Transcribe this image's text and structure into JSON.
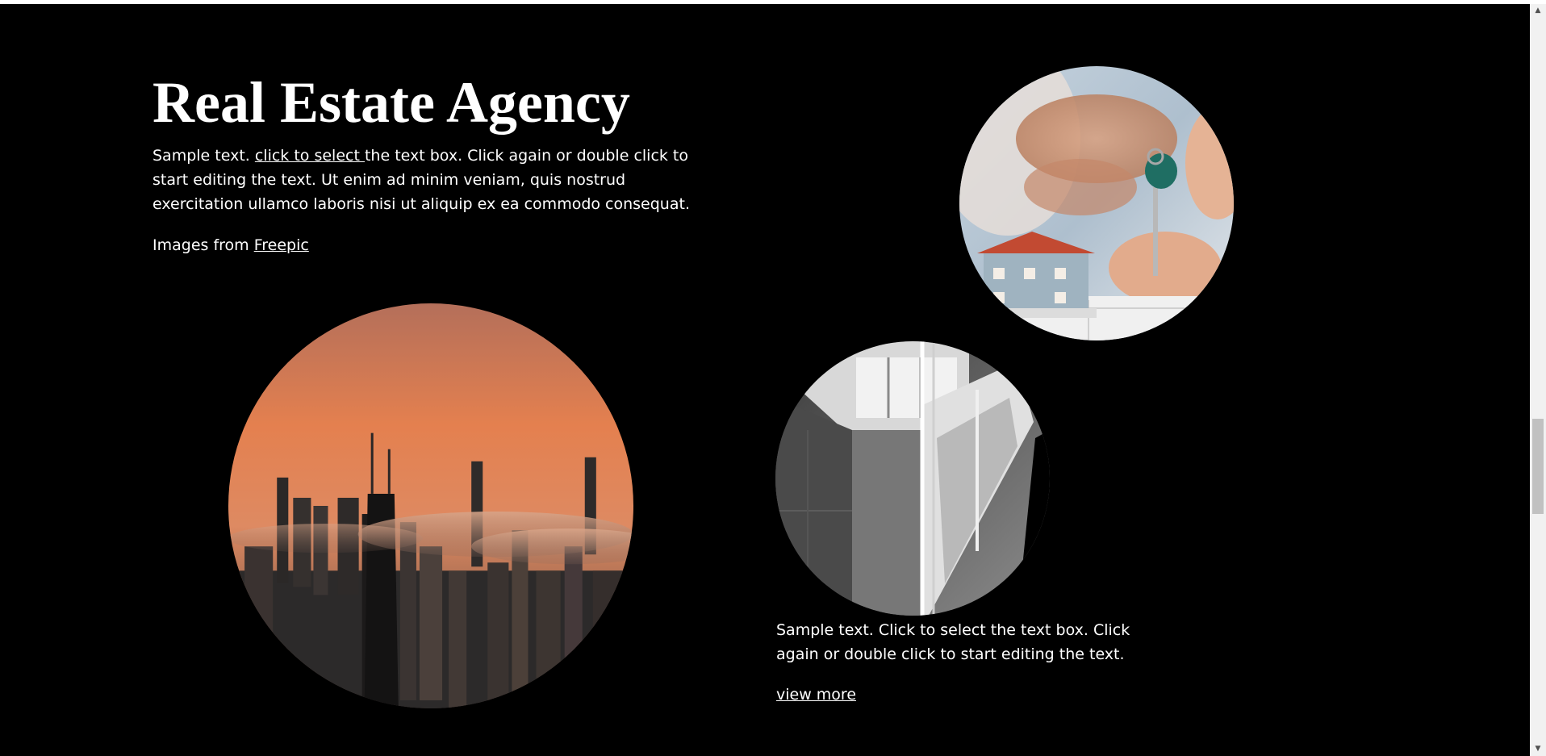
{
  "hero": {
    "title": "Real Estate Agency",
    "intro_before": "Sample text. ",
    "intro_link": "click to select ",
    "intro_after": "the text box. Click again or double click to start editing the text. Ut enim ad minim veniam, quis nostrud exercitation ullamco laboris nisi ut aliquip ex ea commodo consequat.",
    "credit_prefix": "Images from ",
    "credit_link": "Freepic"
  },
  "feature": {
    "caption": "Sample text. Click to select the text box. Click again or double click to start editing the text.",
    "link": "view more"
  },
  "scrollbar": {
    "up_icon": "▲",
    "down_icon": "▼"
  },
  "colors": {
    "background": "#000000",
    "text": "#ffffff",
    "sky_orange": "#e27a4a"
  }
}
